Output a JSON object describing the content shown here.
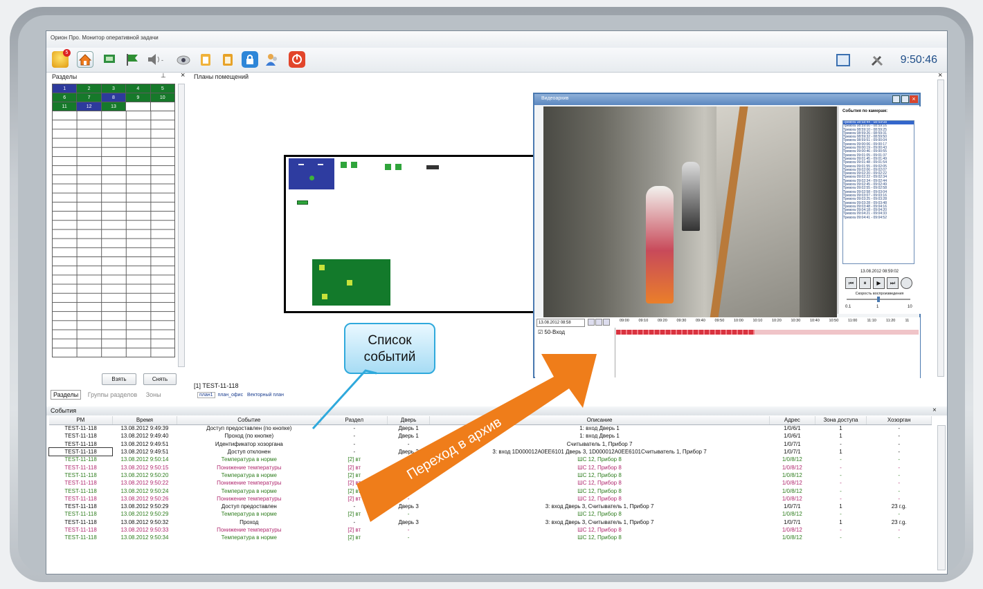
{
  "window": {
    "title": "Орион Про. Монитор оперативной задачи",
    "clock": "9:50:46",
    "badge_count": "5"
  },
  "toolbar": {
    "icons": [
      "alarm-icon",
      "home-icon",
      "camera-view-icon",
      "flag-icon",
      "speaker-icon",
      "webcam-icon",
      "clipboard-icon",
      "document-icon",
      "lock-icon",
      "users-icon",
      "power-icon"
    ]
  },
  "sections_panel": {
    "title": "Разделы",
    "rows": [
      [
        "1",
        "2",
        "3",
        "4",
        "5"
      ],
      [
        "6",
        "7",
        "8",
        "9",
        "10"
      ],
      [
        "11",
        "12",
        "13",
        "",
        ""
      ]
    ],
    "take_label": "Взять",
    "remove_label": "Снять"
  },
  "tabs": [
    "Разделы",
    "Группы разделов",
    "Зоны"
  ],
  "plans": {
    "title": "Планы помещений",
    "device_caption": "[1] TEST-11-118",
    "plan_tabs": [
      "план1",
      "план_офис",
      "Векторный план"
    ]
  },
  "video": {
    "title": "Видеоархив",
    "events_title": "События по камерам:",
    "events": [
      "Тревога 08:58:44 - 08:59:08",
      "Тревога 08:59:00 - 08:59:16",
      "Тревога 08:59:10 - 08:59:25",
      "Тревога 08:59:26 - 08:59:31",
      "Тревога 08:59:32 - 08:59:50",
      "Тревога 08:59:51 - 09:00:04",
      "Тревога 09:00:06 - 09:00:17",
      "Тревога 09:00:19 - 09:00:43",
      "Тревога 09:00:46 - 09:00:55",
      "Тревога 09:01:05 - 09:01:37",
      "Тревога 09:01:45 - 09:01:49",
      "Тревога 09:01:48 - 09:01:54",
      "Тревога 09:01:55 - 09:02:05",
      "Тревога 09:02:06 - 09:02:07",
      "Тревога 09:02:20 - 09:02:22",
      "Тревога 09:02:22 - 09:02:34",
      "Тревога 09:02:34 - 09:02:44",
      "Тревога 09:02:45 - 09:02:49",
      "Тревога 09:02:55 - 09:02:58",
      "Тревога 09:02:58 - 09:03:04",
      "Тревога 09:03:07 - 09:03:16",
      "Тревога 09:03:25 - 09:03:28",
      "Тревога 09:03:28 - 09:03:48",
      "Тревога 09:03:48 - 09:04:16",
      "Тревога 09:04:18 - 09:04:20",
      "Тревога 09:04:21 - 09:04:33",
      "Тревога 09:04:41 - 09:04:52"
    ],
    "timestamp": "13.08.2012 08:59:02",
    "speed_label": "Скорость воспроизведения",
    "speed_values": [
      "0.1",
      "1",
      "10"
    ],
    "timeline_date": "13.08.2012 08:58",
    "timeline_ticks": [
      "09:00",
      "09:10",
      "09:20",
      "09:30",
      "09:40",
      "09:50",
      "10:00",
      "10:10",
      "10:20",
      "10:30",
      "10:40",
      "10:50",
      "11:00",
      "11:10",
      "11:20",
      "11"
    ],
    "camera_name": "50-Вход"
  },
  "events_log": {
    "title": "События",
    "columns": [
      "РМ",
      "Время",
      "Событие",
      "Раздел",
      "Дверь",
      "Описание",
      "Адрес",
      "Зона доступа",
      "Хозорган"
    ],
    "rows": [
      {
        "c": "#111",
        "v": [
          "TEST-11-118",
          "13.08.2012 9:49:39",
          "Доступ предоставлен (по кнопке)",
          "-",
          "Дверь 1",
          "1: вход  Дверь 1",
          "1/0/6/1",
          "1",
          "-"
        ]
      },
      {
        "c": "#111",
        "v": [
          "TEST-11-118",
          "13.08.2012 9:49:40",
          "Проход (по кнопке)",
          "-",
          "Дверь 1",
          "1: вход  Дверь 1",
          "1/0/6/1",
          "1",
          "-"
        ]
      },
      {
        "c": "#111",
        "v": [
          "TEST-11-118",
          "13.08.2012 9:49:51",
          "Идентификатор хозоргана",
          "-",
          "-",
          "Считыватель 1, Прибор 7",
          "1/0/7/1",
          "-",
          "-"
        ]
      },
      {
        "c": "#111",
        "v": [
          "TEST-11-118",
          "13.08.2012 9:49:51",
          "Доступ отклонен",
          "-",
          "Дверь 3",
          "3: вход  1D000012A0EE6101 Дверь 3, 1D000012A0EE6101Считыватель 1, Прибор 7",
          "1/0/7/1",
          "1",
          "-"
        ]
      },
      {
        "c": "#2e7d1e",
        "v": [
          "TEST-11-118",
          "13.08.2012 9:50:14",
          "Температура в норме",
          "[2] вт",
          "-",
          "ШС 12, Прибор 8",
          "1/0/8/12",
          "-",
          "-"
        ]
      },
      {
        "c": "#b0286e",
        "v": [
          "TEST-11-118",
          "13.08.2012 9:50:15",
          "Понижение температуры",
          "[2] вт",
          "-",
          "ШС 12, Прибор 8",
          "1/0/8/12",
          "-",
          "-"
        ]
      },
      {
        "c": "#2e7d1e",
        "v": [
          "TEST-11-118",
          "13.08.2012 9:50:20",
          "Температура в норме",
          "[2] вт",
          "-",
          "ШС 12, Прибор 8",
          "1/0/8/12",
          "-",
          "-"
        ]
      },
      {
        "c": "#b0286e",
        "v": [
          "TEST-11-118",
          "13.08.2012 9:50:22",
          "Понижение температуры",
          "[2] вт",
          "-",
          "ШС 12, Прибор 8",
          "1/0/8/12",
          "-",
          "-"
        ]
      },
      {
        "c": "#2e7d1e",
        "v": [
          "TEST-11-118",
          "13.08.2012 9:50:24",
          "Температура в норме",
          "[2] вт",
          "-",
          "ШС 12, Прибор 8",
          "1/0/8/12",
          "-",
          "-"
        ]
      },
      {
        "c": "#b0286e",
        "v": [
          "TEST-11-118",
          "13.08.2012 9:50:26",
          "Понижение температуры",
          "[2] вт",
          "-",
          "ШС 12, Прибор 8",
          "1/0/8/12",
          "-",
          "-"
        ]
      },
      {
        "c": "#111",
        "v": [
          "TEST-11-118",
          "13.08.2012 9:50:29",
          "Доступ предоставлен",
          "-",
          "Дверь 3",
          "3: вход  Дверь 3, Считыватель 1, Прибор 7",
          "1/0/7/1",
          "1",
          "23 г.g."
        ]
      },
      {
        "c": "#2e7d1e",
        "v": [
          "TEST-11-118",
          "13.08.2012 9:50:29",
          "Температура в норме",
          "[2] вт",
          "-",
          "ШС 12, Прибор 8",
          "1/0/8/12",
          "-",
          "-"
        ]
      },
      {
        "c": "#111",
        "v": [
          "TEST-11-118",
          "13.08.2012 9:50:32",
          "Проход",
          "-",
          "Дверь 3",
          "3: вход  Дверь 3, Считыватель 1, Прибор 7",
          "1/0/7/1",
          "1",
          "23 г.g."
        ]
      },
      {
        "c": "#b0286e",
        "v": [
          "TEST-11-118",
          "13.08.2012 9:50:33",
          "Понижение температуры",
          "[2] вт",
          "-",
          "ШС 12, Прибор 8",
          "1/0/8/12",
          "-",
          "-"
        ]
      },
      {
        "c": "#2e7d1e",
        "v": [
          "TEST-11-118",
          "13.08.2012 9:50:34",
          "Температура в норме",
          "[2] вт",
          "-",
          "ШС 12, Прибор 8",
          "1/0/8/12",
          "-",
          "-"
        ]
      }
    ]
  },
  "annotations": {
    "callout": "Список событий",
    "arrow": "Переход в архив"
  }
}
